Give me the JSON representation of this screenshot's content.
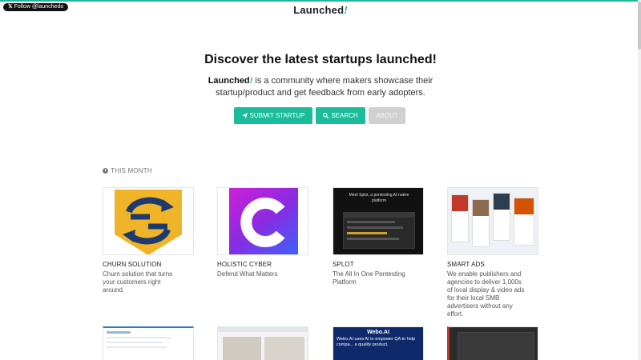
{
  "header": {
    "follow_label": "Follow @launchedo",
    "brand_text": "Launched",
    "brand_bang": "!"
  },
  "hero": {
    "title": "Discover the latest startups launched!",
    "desc_brand": "Launched",
    "desc_bang": "!",
    "desc_rest": " is a community where makers showcase their startup/product and get feedback from early adopters."
  },
  "buttons": {
    "submit": "SUBMIT STARTUP",
    "search": "SEARCH",
    "about": "ABOUT"
  },
  "section": {
    "label": "THIS MONTH"
  },
  "cards": [
    {
      "title": "CHURN SOLUTION",
      "desc": "Churn solution that turns your customers right around."
    },
    {
      "title": "HOLISTIC CYBER",
      "desc": "Defend What Matters"
    },
    {
      "title": "SPLOT",
      "desc": "The All In One Pentesting Platform",
      "thumb_heading": "Meet Splot, a pentesting AI-native platform"
    },
    {
      "title": "SMART ADS",
      "desc": "We enable publishers and agencies to deliver 1,000s of local display & video ads for their local SMB advertisers without any effort."
    }
  ],
  "row2_cards": [
    {
      "thumb_text": ""
    },
    {
      "thumb_text": ""
    },
    {
      "thumb_brand": "Webo.AI",
      "thumb_text": "Webo.AI uses AI to empower QA to help compa... a quality product."
    },
    {
      "thumb_text": ""
    }
  ]
}
